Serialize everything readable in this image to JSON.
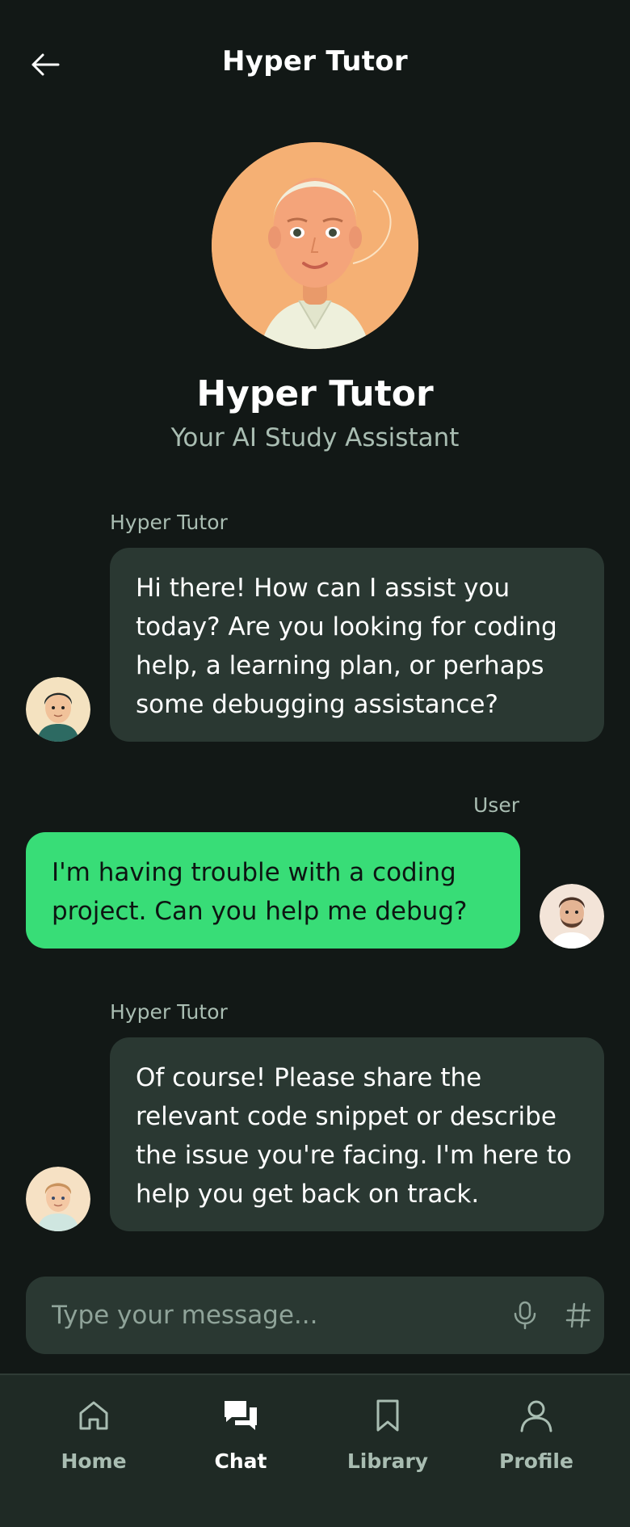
{
  "header": {
    "title": "Hyper Tutor",
    "back_icon": "arrow-left-icon"
  },
  "hero": {
    "name": "Hyper Tutor",
    "subtitle": "Your AI Study Assistant"
  },
  "messages": [
    {
      "sender": "Hyper Tutor",
      "role": "bot",
      "text": "Hi there! How can I assist you today? Are you looking for coding help, a learning plan, or perhaps some debugging assistance?"
    },
    {
      "sender": "User",
      "role": "user",
      "text": "I'm having trouble with a coding project. Can you help me debug?"
    },
    {
      "sender": "Hyper Tutor",
      "role": "bot",
      "text": "Of course! Please share the relevant code snippet or describe the issue you're facing. I'm here to help you get back on track."
    }
  ],
  "composer": {
    "placeholder": "Type your message...",
    "mic_icon": "microphone-icon",
    "hash_icon": "hashtag-icon"
  },
  "nav": {
    "items": [
      {
        "label": "Home",
        "icon": "home-icon",
        "active": false
      },
      {
        "label": "Chat",
        "icon": "chat-icon",
        "active": true
      },
      {
        "label": "Library",
        "icon": "bookmark-icon",
        "active": false
      },
      {
        "label": "Profile",
        "icon": "user-icon",
        "active": false
      }
    ]
  },
  "colors": {
    "background": "#121816",
    "bot_bubble": "#2a3832",
    "user_bubble": "#38dd77",
    "muted_text": "#a9bdb2",
    "nav_background": "#1f2a25"
  }
}
